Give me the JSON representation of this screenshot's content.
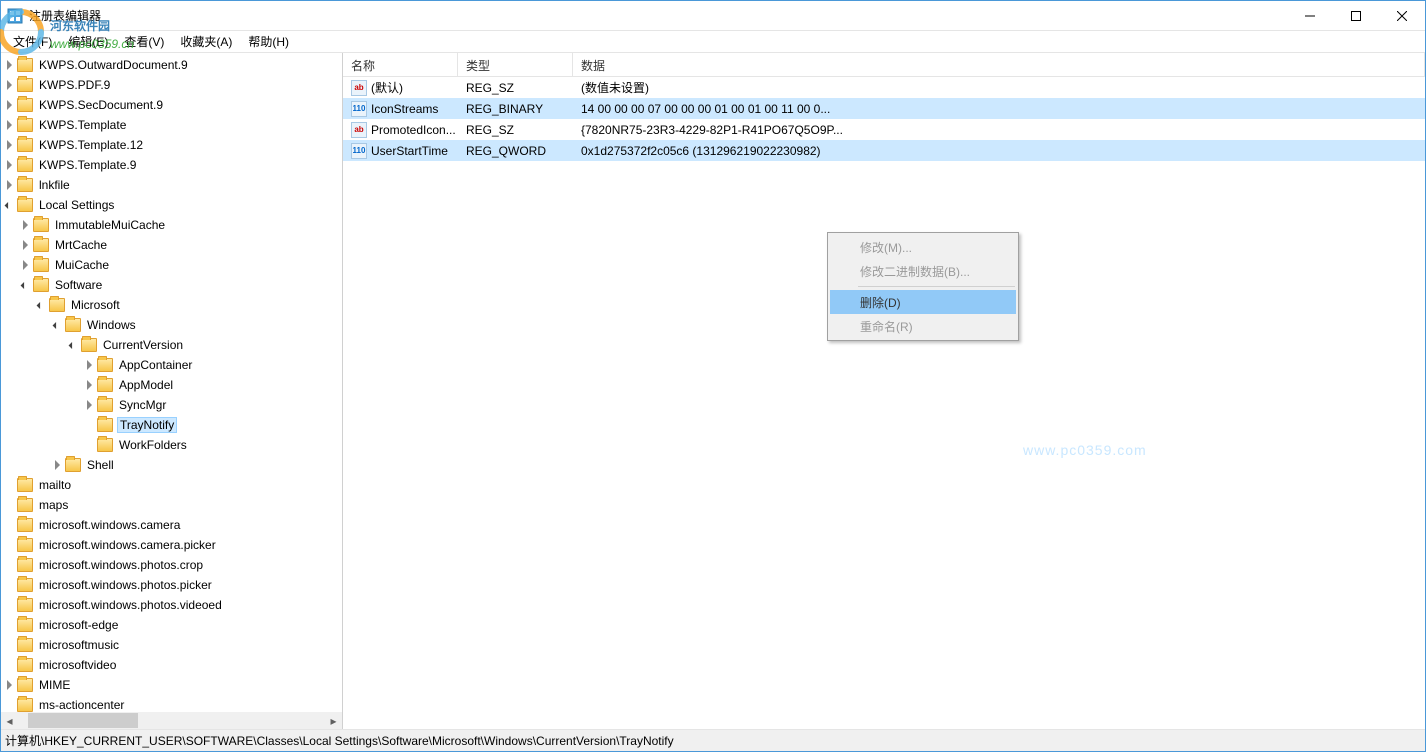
{
  "window": {
    "title": "注册表编辑器"
  },
  "menu": {
    "file": "文件(F)",
    "edit": "编辑(E)",
    "view": "查看(V)",
    "fav": "收藏夹(A)",
    "help": "帮助(H)"
  },
  "tree": [
    {
      "d": 5,
      "e": "closed",
      "l": "KWPS.OutwardDocument.9"
    },
    {
      "d": 5,
      "e": "closed",
      "l": "KWPS.PDF.9"
    },
    {
      "d": 5,
      "e": "closed",
      "l": "KWPS.SecDocument.9"
    },
    {
      "d": 5,
      "e": "closed",
      "l": "KWPS.Template"
    },
    {
      "d": 5,
      "e": "closed",
      "l": "KWPS.Template.12"
    },
    {
      "d": 5,
      "e": "closed",
      "l": "KWPS.Template.9"
    },
    {
      "d": 5,
      "e": "closed",
      "l": "lnkfile"
    },
    {
      "d": 5,
      "e": "open",
      "l": "Local Settings"
    },
    {
      "d": 6,
      "e": "closed",
      "l": "ImmutableMuiCache"
    },
    {
      "d": 6,
      "e": "closed",
      "l": "MrtCache"
    },
    {
      "d": 6,
      "e": "closed",
      "l": "MuiCache"
    },
    {
      "d": 6,
      "e": "open",
      "l": "Software"
    },
    {
      "d": 7,
      "e": "open",
      "l": "Microsoft"
    },
    {
      "d": 8,
      "e": "open",
      "l": "Windows"
    },
    {
      "d": 9,
      "e": "open",
      "l": "CurrentVersion"
    },
    {
      "d": 10,
      "e": "closed",
      "l": "AppContainer"
    },
    {
      "d": 10,
      "e": "closed",
      "l": "AppModel"
    },
    {
      "d": 10,
      "e": "closed",
      "l": "SyncMgr"
    },
    {
      "d": 10,
      "e": "none",
      "l": "TrayNotify",
      "sel": true
    },
    {
      "d": 10,
      "e": "none",
      "l": "WorkFolders"
    },
    {
      "d": 8,
      "e": "closed",
      "l": "Shell"
    },
    {
      "d": 5,
      "e": "none",
      "l": "mailto"
    },
    {
      "d": 5,
      "e": "none",
      "l": "maps"
    },
    {
      "d": 5,
      "e": "none",
      "l": "microsoft.windows.camera"
    },
    {
      "d": 5,
      "e": "none",
      "l": "microsoft.windows.camera.picker"
    },
    {
      "d": 5,
      "e": "none",
      "l": "microsoft.windows.photos.crop"
    },
    {
      "d": 5,
      "e": "none",
      "l": "microsoft.windows.photos.picker"
    },
    {
      "d": 5,
      "e": "none",
      "l": "microsoft.windows.photos.videoed"
    },
    {
      "d": 5,
      "e": "none",
      "l": "microsoft-edge"
    },
    {
      "d": 5,
      "e": "none",
      "l": "microsoftmusic"
    },
    {
      "d": 5,
      "e": "none",
      "l": "microsoftvideo"
    },
    {
      "d": 5,
      "e": "closed",
      "l": "MIME"
    },
    {
      "d": 5,
      "e": "none",
      "l": "ms-actioncenter"
    }
  ],
  "listHeaders": {
    "name": "名称",
    "type": "类型",
    "data": "数据"
  },
  "values": [
    {
      "icon": "str",
      "name": "(默认)",
      "type": "REG_SZ",
      "data": "(数值未设置)",
      "sel": false
    },
    {
      "icon": "bin",
      "name": "IconStreams",
      "type": "REG_BINARY",
      "data": "14 00 00 00 07 00 00 00 01 00 01 00 11 00 0...",
      "sel": true
    },
    {
      "icon": "str",
      "name": "PromotedIcon...",
      "type": "REG_SZ",
      "data": "{7820NR75-23R3-4229-82P1-R41PO67Q5O9P...",
      "sel": false
    },
    {
      "icon": "bin",
      "name": "UserStartTime",
      "type": "REG_QWORD",
      "data": "0x1d275372f2c05c6 (131296219022230982)",
      "sel": true
    }
  ],
  "contextMenu": {
    "modify": "修改(M)...",
    "modifyBinary": "修改二进制数据(B)...",
    "delete": "删除(D)",
    "rename": "重命名(R)"
  },
  "status": "计算机\\HKEY_CURRENT_USER\\SOFTWARE\\Classes\\Local Settings\\Software\\Microsoft\\Windows\\CurrentVersion\\TrayNotify",
  "watermark": {
    "topText1": "河东软件园",
    "topText2": "www.pc0359.cn",
    "center": "www.pc0359.com"
  }
}
